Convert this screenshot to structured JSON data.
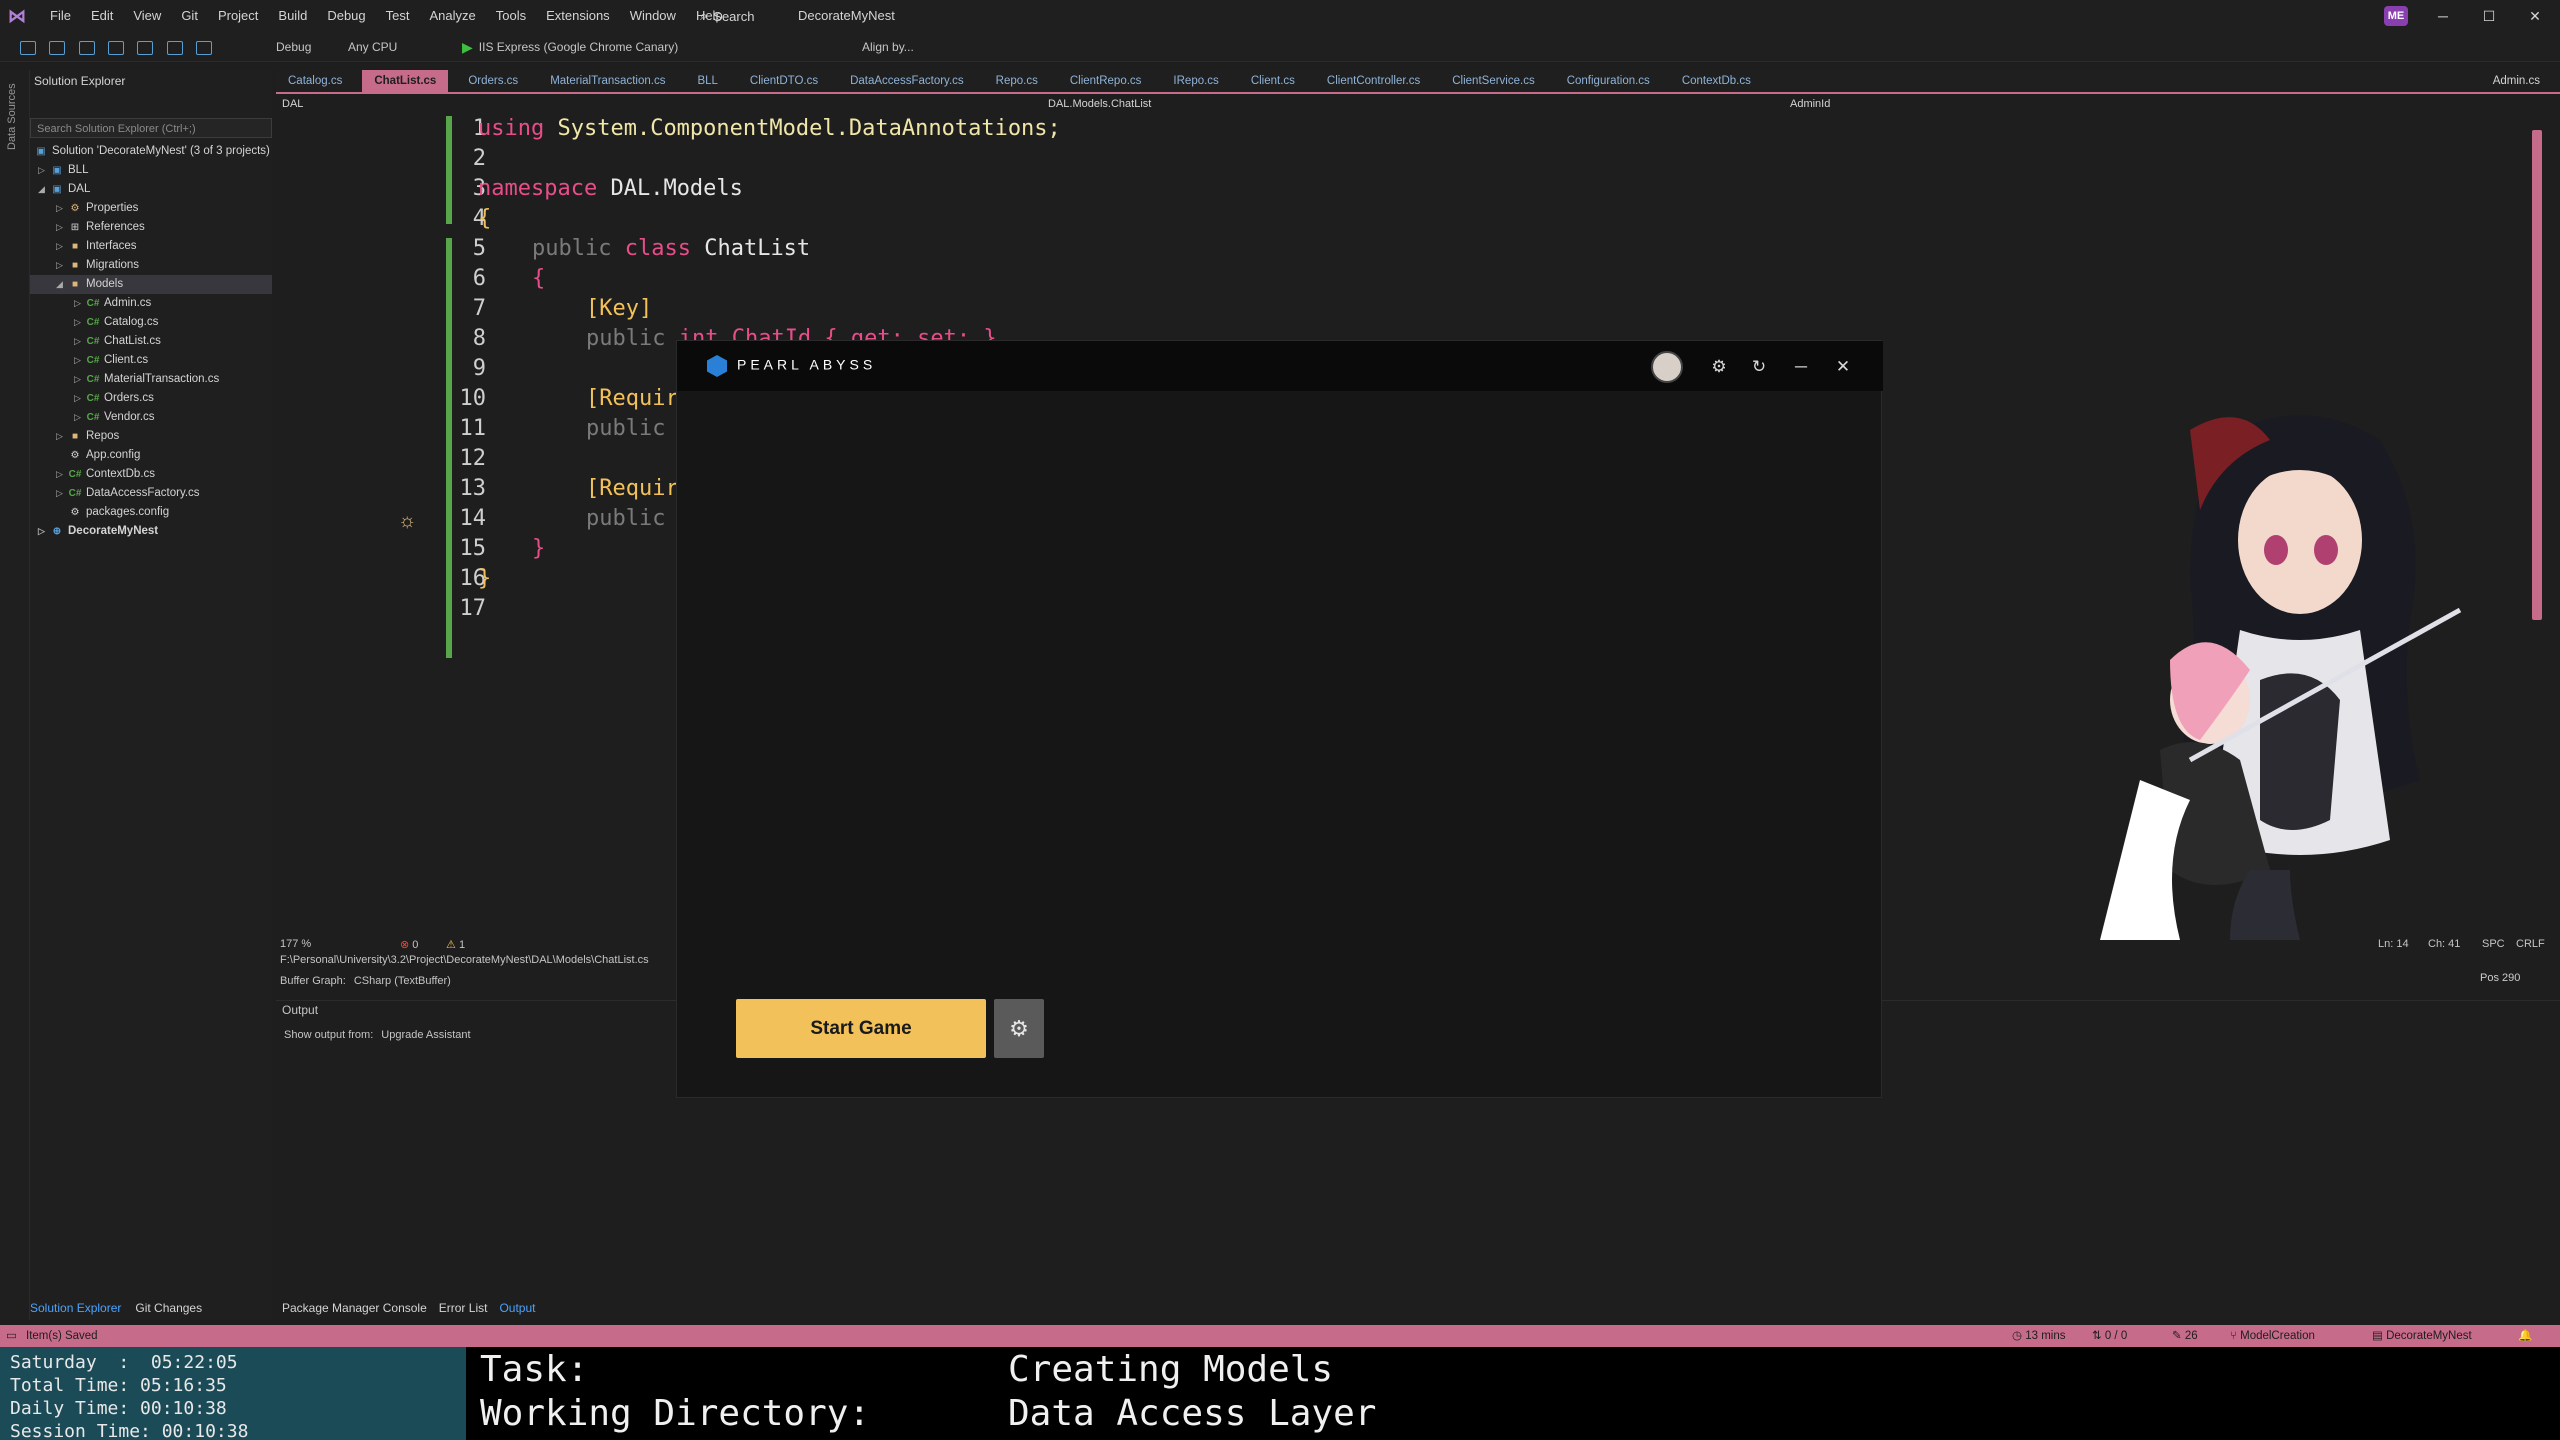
{
  "menubar": {
    "items": [
      "File",
      "Edit",
      "View",
      "Git",
      "Project",
      "Build",
      "Debug",
      "Test",
      "Analyze",
      "Tools",
      "Extensions",
      "Window",
      "Help"
    ],
    "search_label": "Search",
    "solution_name": "DecorateMyNest",
    "avatar": "ME"
  },
  "toolbar": {
    "config": "Debug",
    "platform": "Any CPU",
    "run_target": "IIS Express (Google Chrome Canary)",
    "align_label": "Align by..."
  },
  "left_rail": {
    "label": "Data Sources"
  },
  "solution_explorer": {
    "title": "Solution Explorer",
    "search_placeholder": "Search Solution Explorer (Ctrl+;)",
    "items": [
      {
        "label": "Solution 'DecorateMyNest' (3 of 3 projects)",
        "icon": "solution-icon"
      },
      {
        "label": "BLL",
        "icon": "project-icon"
      },
      {
        "label": "DAL",
        "icon": "project-icon"
      },
      {
        "label": "Properties",
        "icon": "wrench-icon"
      },
      {
        "label": "References",
        "icon": "references-icon"
      },
      {
        "label": "Interfaces",
        "icon": "folder-icon"
      },
      {
        "label": "Migrations",
        "icon": "folder-icon"
      },
      {
        "label": "Models",
        "icon": "folder-icon"
      },
      {
        "label": "Admin.cs",
        "icon": "csharp-icon"
      },
      {
        "label": "Catalog.cs",
        "icon": "csharp-icon"
      },
      {
        "label": "ChatList.cs",
        "icon": "csharp-icon"
      },
      {
        "label": "Client.cs",
        "icon": "csharp-icon"
      },
      {
        "label": "MaterialTransaction.cs",
        "icon": "csharp-icon"
      },
      {
        "label": "Orders.cs",
        "icon": "csharp-icon"
      },
      {
        "label": "Vendor.cs",
        "icon": "csharp-icon"
      },
      {
        "label": "Repos",
        "icon": "folder-icon"
      },
      {
        "label": "App.config",
        "icon": "config-icon"
      },
      {
        "label": "ContextDb.cs",
        "icon": "csharp-icon"
      },
      {
        "label": "DataAccessFactory.cs",
        "icon": "csharp-icon"
      },
      {
        "label": "packages.config",
        "icon": "config-icon"
      },
      {
        "label": "DecorateMyNest",
        "icon": "web-project-icon"
      }
    ],
    "bottom_tabs": [
      "Solution Explorer",
      "Git Changes"
    ]
  },
  "tabs": [
    "Catalog.cs",
    "ChatList.cs",
    "Orders.cs",
    "MaterialTransaction.cs",
    "BLL",
    "ClientDTO.cs",
    "DataAccessFactory.cs",
    "Repo.cs",
    "ClientRepo.cs",
    "IRepo.cs",
    "Client.cs",
    "ClientController.cs",
    "ClientService.cs",
    "Configuration.cs",
    "ContextDb.cs",
    "Admin.cs"
  ],
  "navbar": {
    "project": "DAL",
    "type": "DAL.Models.ChatList",
    "member": "AdminId"
  },
  "editor": {
    "line_numbers": [
      "1",
      "2",
      "3",
      "4",
      "5",
      "6",
      "7",
      "8",
      "9",
      "10",
      "11",
      "12",
      "13",
      "14",
      "15",
      "16",
      "17"
    ],
    "lines": {
      "l1_kw": "using",
      "l1_rest": " System.ComponentModel.DataAnnotations;",
      "l3_kw": "namespace",
      "l3_rest": " DAL.Models",
      "brace_open": "{",
      "brace_close": "}",
      "l5_public": "public",
      "l5_class": " class",
      "l5_name": " ChatList",
      "l7": "[Key]",
      "l8_public": "public",
      "l8_rest": " int ChatId { get; set; }",
      "l10": "[Requir",
      "l11": "public",
      "l13": "[Requir",
      "l14": "public"
    }
  },
  "editor_footer": {
    "zoom": "177 %",
    "errors": "0",
    "warnings": "1",
    "ln": "Ln: 14",
    "ch": "Ch: 41",
    "spc": "SPC",
    "crlf": "CRLF",
    "path": "F:\\Personal\\University\\3.2\\Project\\DecorateMyNest\\DAL\\Models\\ChatList.cs",
    "buffer_graph_label": "Buffer Graph:",
    "buffer_graph_value": "CSharp (TextBuffer)",
    "pos": "Pos 290"
  },
  "output": {
    "title": "Output",
    "show_from_label": "Show output from:",
    "show_from_value": "Upgrade Assistant"
  },
  "bottom_tabs": [
    "Package Manager Console",
    "Error List",
    "Output"
  ],
  "statusbar": {
    "message": "Item(s) Saved",
    "time": "13 mins",
    "vcs": "0 / 0",
    "edits": "26",
    "branch": "ModelCreation",
    "repo": "DecorateMyNest"
  },
  "timer": {
    "day_line": "Saturday  :  05:22:05",
    "total_line": "Total Time: 05:16:35",
    "daily_line": "Daily Time: 00:10:38",
    "session_line": "Session Time: 00:10:38"
  },
  "task": {
    "task_label": "Task:",
    "task_value": "Creating Models",
    "dir_label": "Working Directory:",
    "dir_value": "Data Access Layer"
  },
  "launcher": {
    "brand": "PEARL ABYSS",
    "start_button": "Start Game",
    "accent": "#f2c15a"
  },
  "colors": {
    "accent": "#c76b8b",
    "keyword": "#e84d8a",
    "git_added": "#57a64a"
  }
}
